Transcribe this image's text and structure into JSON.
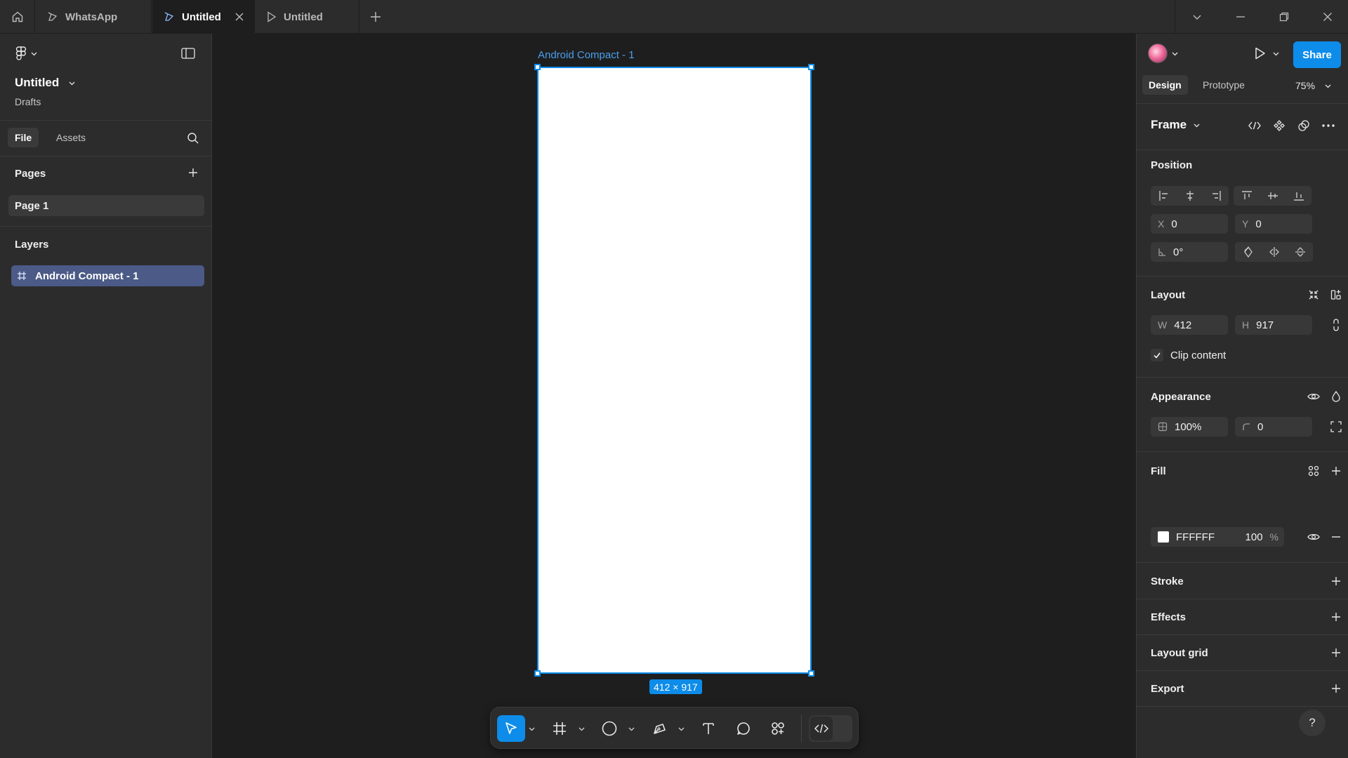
{
  "tabs": [
    {
      "label": "WhatsApp",
      "icon": "design-file-icon"
    },
    {
      "label": "Untitled",
      "icon": "design-file-icon",
      "active": true
    },
    {
      "label": "Untitled",
      "icon": "prototype-play-icon"
    }
  ],
  "file": {
    "title": "Untitled",
    "location": "Drafts"
  },
  "left_tabs": {
    "file": "File",
    "assets": "Assets"
  },
  "pages": {
    "heading": "Pages",
    "items": [
      "Page 1"
    ]
  },
  "layers": {
    "heading": "Layers",
    "items": [
      "Android Compact - 1"
    ]
  },
  "canvas": {
    "frame_label": "Android Compact - 1",
    "size_badge": "412 × 917",
    "frame_fill": "#FFFFFF",
    "selection_color": "#0D8CE9"
  },
  "right": {
    "share": "Share",
    "mode_tabs": {
      "design": "Design",
      "prototype": "Prototype"
    },
    "zoom": "75%",
    "selection_type": "Frame",
    "position": {
      "heading": "Position",
      "x_label": "X",
      "x": "0",
      "y_label": "Y",
      "y": "0",
      "rotation": "0°"
    },
    "layout": {
      "heading": "Layout",
      "w_label": "W",
      "w": "412",
      "h_label": "H",
      "h": "917",
      "clip_content": "Clip content"
    },
    "appearance": {
      "heading": "Appearance",
      "opacity": "100%",
      "radius": "0"
    },
    "fill": {
      "heading": "Fill",
      "hex": "FFFFFF",
      "opacity": "100",
      "percent": "%"
    },
    "stroke": "Stroke",
    "effects": "Effects",
    "layout_grid": "Layout grid",
    "export": "Export",
    "help": "?"
  }
}
